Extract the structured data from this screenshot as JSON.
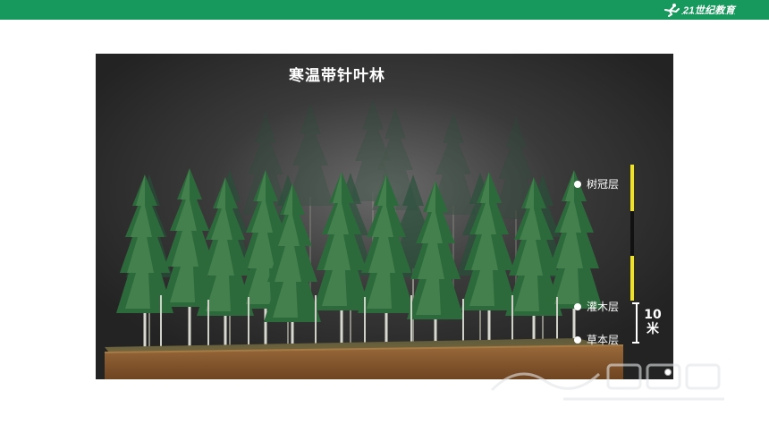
{
  "header": {
    "logo_text": "21世纪教育",
    "brand_color": "#17985c"
  },
  "slide": {
    "title": "寒温带针叶林",
    "layers": [
      {
        "label": "树冠层"
      },
      {
        "label": "灌木层"
      },
      {
        "label": "草本层"
      }
    ],
    "scale_number": "10",
    "scale_unit": "米"
  },
  "icons": {
    "logo": "runner-logo-icon",
    "watermark": "watermark-logo-icon",
    "corner": "corner-dot-icon"
  },
  "colors": {
    "scale_bar_yellow": "#f2e21a",
    "soil": "#8a5a2e",
    "foliage": "#2f6b3c"
  }
}
